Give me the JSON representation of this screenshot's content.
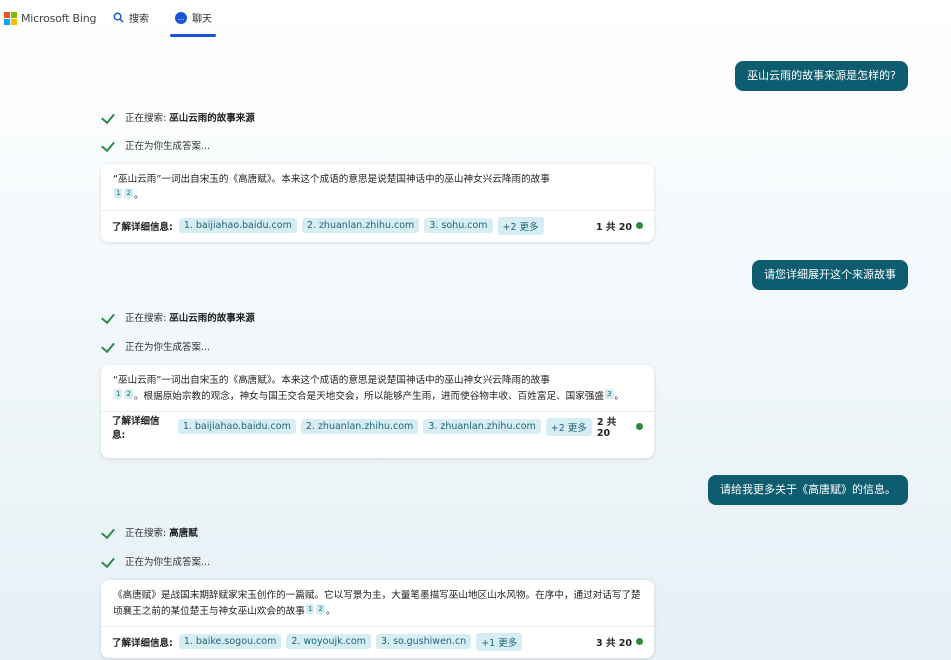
{
  "header": {
    "brand": "Microsoft Bing",
    "tabs": [
      {
        "label": "搜索",
        "icon": "search-icon"
      },
      {
        "label": "聊天",
        "icon": "chat-icon",
        "active": true
      }
    ]
  },
  "conversation": [
    {
      "user": "巫山云雨的故事来源是怎样的?",
      "searching_prefix": "正在搜索:",
      "searching_query": "巫山云雨的故事来源",
      "generating": "正在为你生成答案...",
      "answer_parts": [
        "“巫山云雨”一词出自宋玉的《高唐赋》。本来这个成语的意思是说楚国神话中的巫山神女兴云降雨的故事",
        "。"
      ],
      "refs": [
        "1",
        "2"
      ],
      "learn_more": "了解详细信息:",
      "sources": [
        "1. baijiahao.baidu.com",
        "2. zhuanlan.zhihu.com",
        "3. sohu.com",
        "+2 更多"
      ],
      "count": "1 共 20"
    },
    {
      "user": "请您详细展开这个来源故事",
      "searching_prefix": "正在搜索:",
      "searching_query": "巫山云雨的故事来源",
      "generating": "正在为你生成答案...",
      "answer_parts": [
        "“巫山云雨”一词出自宋玉的《高唐赋》。本来这个成语的意思是说楚国神话中的巫山神女兴云降雨的故事",
        "。根据原始宗教的观念，神女与国王交合是天地交会，所以能够产生雨，进而使谷物丰收、百姓富足、国家强盛",
        "。"
      ],
      "refs": [
        "1",
        "2",
        "3"
      ],
      "learn_more": "了解详细信息:",
      "sources": [
        "1. baijiahao.baidu.com",
        "2. zhuanlan.zhihu.com",
        "3. zhuanlan.zhihu.com",
        "+2 更多"
      ],
      "count": "2 共 20"
    },
    {
      "user": "请给我更多关于《高唐赋》的信息。",
      "searching_prefix": "正在搜索:",
      "searching_query": "高唐赋",
      "generating": "正在为你生成答案...",
      "answer_parts": [
        "《高唐赋》是战国末期辞赋家宋玉创作的一篇赋。它以写景为主，大量笔墨描写巫山地区山水风物。在序中，通过对话写了楚顷襄王之前的某位楚王与神女巫山欢会的故事",
        "。"
      ],
      "refs": [
        "1",
        "2"
      ],
      "learn_more": "了解详细信息:",
      "sources": [
        "1. baike.sogou.com",
        "2. woyoujk.com",
        "3. so.gushiwen.cn",
        "+1 更多"
      ],
      "count": "3 共 20"
    }
  ]
}
